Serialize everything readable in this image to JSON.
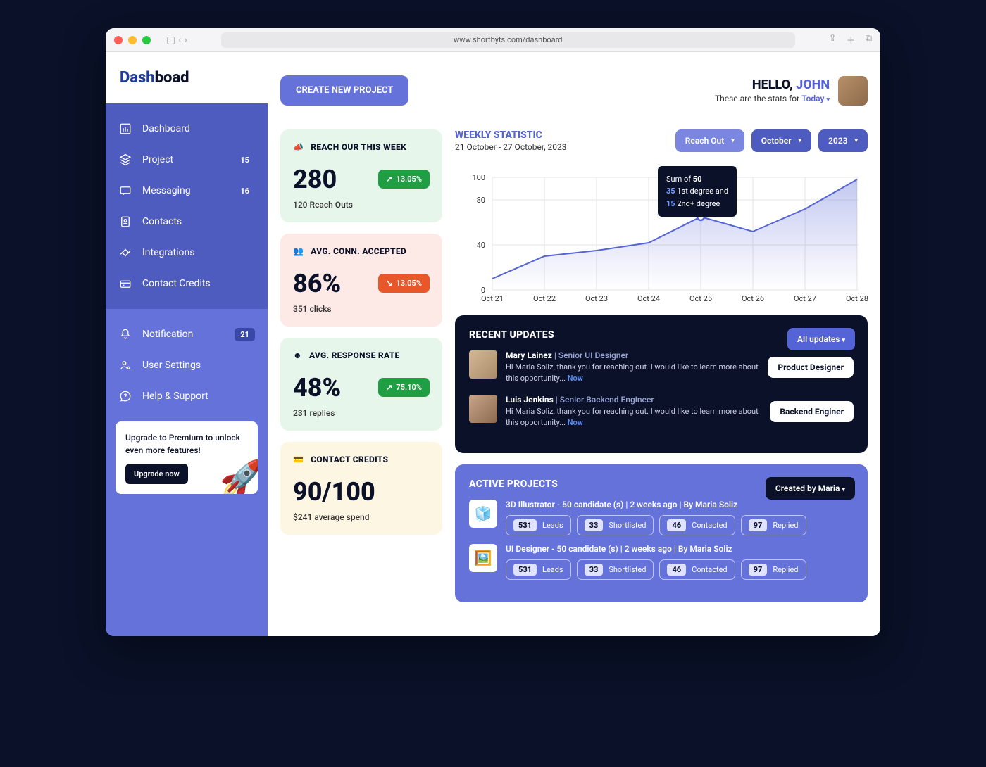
{
  "url": "www.shortbyts.com/dashboard",
  "logo": {
    "part1": "Dash",
    "part2": "boad"
  },
  "sidebar": {
    "main": [
      {
        "label": "Dashboard",
        "icon": "dashboard"
      },
      {
        "label": "Project",
        "icon": "project",
        "badge": "15"
      },
      {
        "label": "Messaging",
        "icon": "messaging",
        "badge": "16"
      },
      {
        "label": "Contacts",
        "icon": "contacts"
      },
      {
        "label": "Integrations",
        "icon": "integrations"
      },
      {
        "label": "Contact Credits",
        "icon": "credits"
      }
    ],
    "bottom": [
      {
        "label": "Notification",
        "icon": "bell",
        "badge": "21"
      },
      {
        "label": "User Settings",
        "icon": "settings"
      },
      {
        "label": "Help & Support",
        "icon": "help"
      }
    ]
  },
  "promo": {
    "text": "Upgrade to Premium to unlock even more features!",
    "button": "Upgrade now"
  },
  "header": {
    "create_btn": "CREATE NEW PROJECT",
    "greeting_prefix": "HELLO, ",
    "greeting_name": "JOHN",
    "stats_prefix": "These are the stats for ",
    "period": "Today"
  },
  "stats": [
    {
      "title": "REACH OUR THIS WEEK",
      "value": "280",
      "delta": "13.05%",
      "direction": "up",
      "sub": "120 Reach Outs",
      "theme": "green",
      "icon": "megaphone"
    },
    {
      "title": "AVG. CONN. ACCEPTED",
      "value": "86%",
      "delta": "13.05%",
      "direction": "down",
      "sub": "351 clicks",
      "theme": "pink",
      "icon": "users"
    },
    {
      "title": "AVG. RESPONSE RATE",
      "value": "48%",
      "delta": "75.10%",
      "direction": "up",
      "sub": "231 replies",
      "theme": "green",
      "icon": "smile"
    },
    {
      "title": "CONTACT CREDITS",
      "value": "90/100",
      "delta": "",
      "direction": "",
      "sub": "$241 average spend",
      "theme": "cream",
      "icon": "card"
    }
  ],
  "chart": {
    "title": "WEEKLY STATISTIC",
    "range": "21 October - 27 October, 2023",
    "filters": [
      "Reach Out",
      "October",
      "2023"
    ]
  },
  "chart_data": {
    "type": "line",
    "title": "WEEKLY STATISTIC",
    "xlabel": "",
    "ylabel": "",
    "ylim": [
      0,
      100
    ],
    "yticks": [
      0,
      40,
      80,
      100
    ],
    "categories": [
      "Oct 21",
      "Oct 22",
      "Oct 23",
      "Oct 24",
      "Oct 25",
      "Oct 26",
      "Oct 27",
      "Oct 28"
    ],
    "values": [
      10,
      30,
      35,
      42,
      65,
      52,
      72,
      98
    ],
    "tooltip": {
      "at": "Oct 25",
      "sum_label": "Sum of ",
      "sum": 50,
      "first_degree": {
        "value": 35,
        "label": "1st degree and"
      },
      "second_degree": {
        "value": 15,
        "label": "2nd+ degree"
      }
    }
  },
  "updates": {
    "title": "RECENT UPDATES",
    "filter_btn": "All updates",
    "items": [
      {
        "name": "Mary Lainez",
        "role": "Senior UI Designer",
        "msg": "Hi Maria Soliz, thank you for reaching out. I would like to learn more about this opportunity... ",
        "time": "Now",
        "tag": "Product Designer"
      },
      {
        "name": "Luis Jenkins",
        "role": "Senior Backend Engineer",
        "msg": "Hi Maria Soliz, thank you for reaching out. I would like to learn more about this opportunity... ",
        "time": "Now",
        "tag": "Backend Enginer"
      }
    ]
  },
  "projects": {
    "title": "ACTIVE PROJECTS",
    "filter_btn": "Created by Maria",
    "items": [
      {
        "title": "3D Illustrator  -  50 candidate (s) | 2 weeks ago | By Maria Soliz",
        "icon": "🧊",
        "stats": [
          {
            "n": "531",
            "l": "Leads"
          },
          {
            "n": "33",
            "l": "Shortlisted"
          },
          {
            "n": "46",
            "l": "Contacted"
          },
          {
            "n": "97",
            "l": "Replied"
          }
        ]
      },
      {
        "title": "UI Designer -  50 candidate (s) | 2 weeks ago | By Maria Soliz",
        "icon": "🖼️",
        "stats": [
          {
            "n": "531",
            "l": "Leads"
          },
          {
            "n": "33",
            "l": "Shortlisted"
          },
          {
            "n": "46",
            "l": "Contacted"
          },
          {
            "n": "97",
            "l": "Replied"
          }
        ]
      }
    ]
  }
}
